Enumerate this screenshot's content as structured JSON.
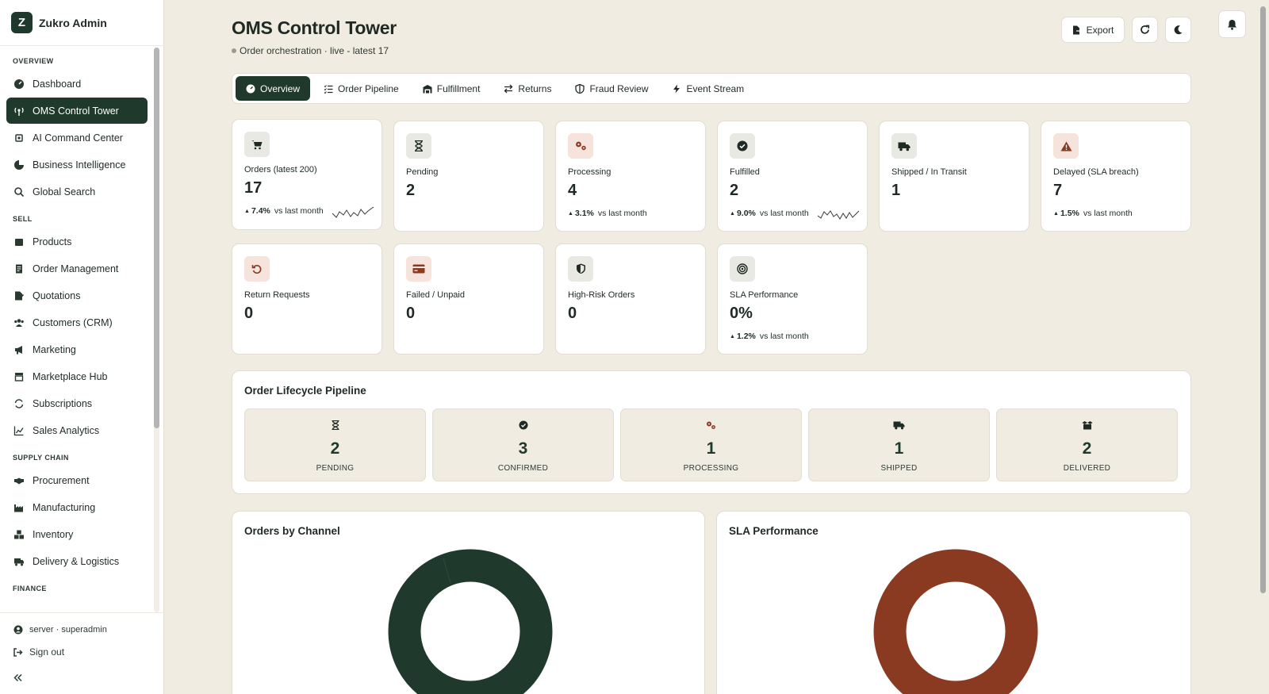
{
  "sidebar": {
    "brand_letter": "Z",
    "brand_name": "Zukro Admin",
    "sections": {
      "overview": "OVERVIEW",
      "sell": "SELL",
      "supply_chain": "SUPPLY CHAIN",
      "finance": "FINANCE"
    },
    "items": {
      "dashboard": "Dashboard",
      "oms": "OMS Control Tower",
      "ai": "AI Command Center",
      "bi": "Business Intelligence",
      "search": "Global Search",
      "products": "Products",
      "orders": "Order Management",
      "quotations": "Quotations",
      "crm": "Customers (CRM)",
      "marketing": "Marketing",
      "marketplace": "Marketplace Hub",
      "subscriptions": "Subscriptions",
      "sales": "Sales Analytics",
      "procurement": "Procurement",
      "manufacturing": "Manufacturing",
      "inventory": "Inventory",
      "delivery": "Delivery & Logistics"
    },
    "footer": {
      "user": "server · superadmin",
      "signout": "Sign out"
    }
  },
  "header": {
    "title": "OMS Control Tower",
    "subtitle": "Order orchestration · live - latest 17",
    "export_label": "Export"
  },
  "tabs": {
    "overview": "Overview",
    "pipeline": "Order Pipeline",
    "fulfillment": "Fulfillment",
    "returns": "Returns",
    "fraud": "Fraud Review",
    "events": "Event Stream"
  },
  "kpis": {
    "orders": {
      "label": "Orders (latest 200)",
      "value": "17",
      "trend": "7.4%",
      "trend_text": "vs last month"
    },
    "pending": {
      "label": "Pending",
      "value": "2"
    },
    "processing": {
      "label": "Processing",
      "value": "4",
      "trend": "3.1%",
      "trend_text": "vs last month"
    },
    "fulfilled": {
      "label": "Fulfilled",
      "value": "2",
      "trend": "9.0%",
      "trend_text": "vs last month"
    },
    "shipped": {
      "label": "Shipped / In Transit",
      "value": "1"
    },
    "delayed": {
      "label": "Delayed (SLA breach)",
      "value": "7",
      "trend": "1.5%",
      "trend_text": "vs last month"
    },
    "returns": {
      "label": "Return Requests",
      "value": "0"
    },
    "failed": {
      "label": "Failed / Unpaid",
      "value": "0"
    },
    "risk": {
      "label": "High-Risk Orders",
      "value": "0"
    },
    "sla": {
      "label": "SLA Performance",
      "value": "0%",
      "trend": "1.2%",
      "trend_text": "vs last month"
    }
  },
  "pipeline": {
    "title": "Order Lifecycle Pipeline",
    "stages": {
      "pending": {
        "count": "2",
        "label": "PENDING"
      },
      "confirmed": {
        "count": "3",
        "label": "CONFIRMED"
      },
      "processing": {
        "count": "1",
        "label": "PROCESSING"
      },
      "shipped": {
        "count": "1",
        "label": "SHIPPED"
      },
      "delivered": {
        "count": "2",
        "label": "DELIVERED"
      }
    }
  },
  "charts": {
    "channel_title": "Orders by Channel",
    "sla_title": "SLA Performance"
  },
  "colors": {
    "accent_green": "#1f3a2c",
    "accent_red": "#8b3a22",
    "background": "#f1ece2"
  }
}
